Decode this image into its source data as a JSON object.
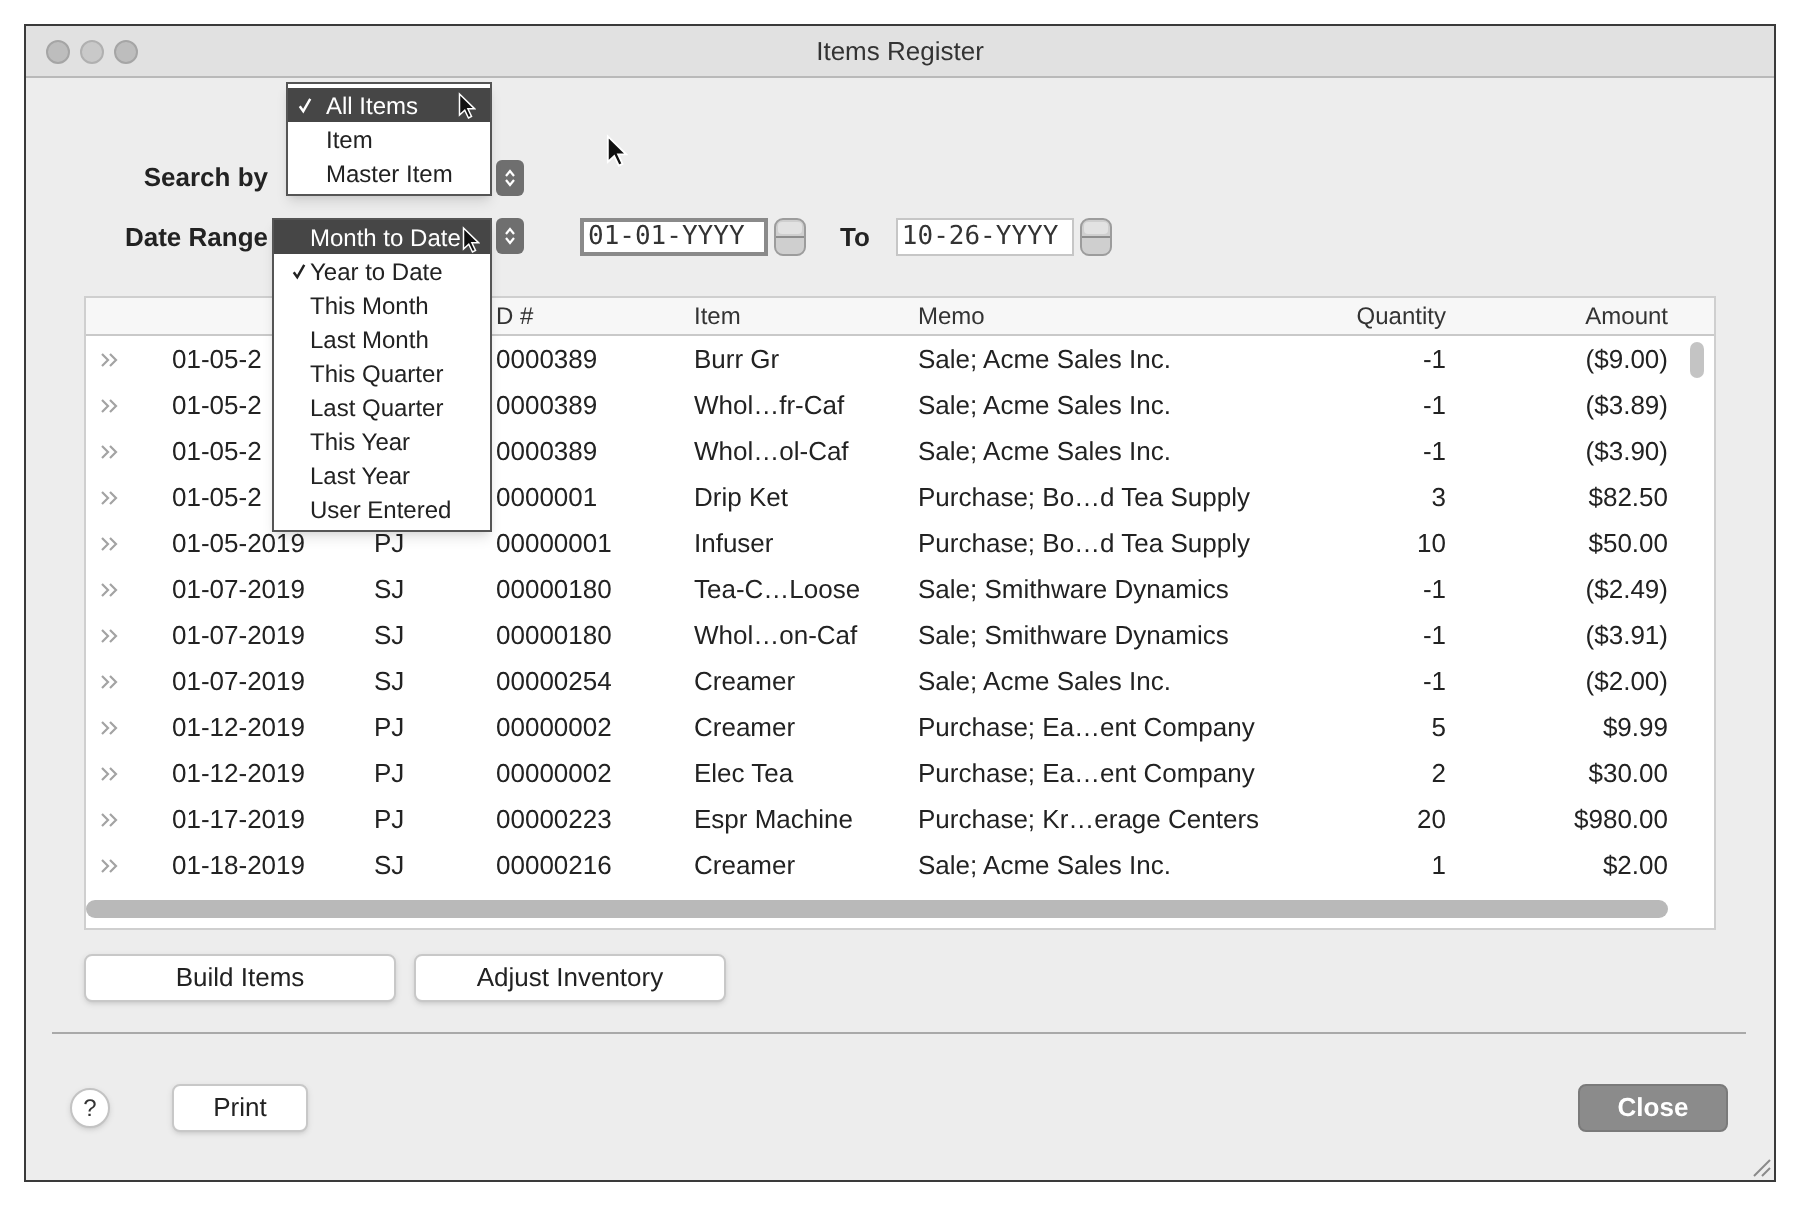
{
  "window": {
    "title": "Items Register"
  },
  "search_by": {
    "label": "Search by",
    "menu": [
      {
        "label": "All Items",
        "checked": true,
        "selected": true
      },
      {
        "label": "Item",
        "checked": false,
        "selected": false
      },
      {
        "label": "Master Item",
        "checked": false,
        "selected": false
      }
    ]
  },
  "date_range": {
    "label": "Date Range",
    "menu": [
      {
        "label": "Month to Date",
        "checked": false,
        "selected": true
      },
      {
        "label": "Year to Date",
        "checked": true,
        "selected": false
      },
      {
        "label": "This Month",
        "checked": false,
        "selected": false
      },
      {
        "label": "Last Month",
        "checked": false,
        "selected": false
      },
      {
        "label": "This Quarter",
        "checked": false,
        "selected": false
      },
      {
        "label": "Last Quarter",
        "checked": false,
        "selected": false
      },
      {
        "label": "This Year",
        "checked": false,
        "selected": false
      },
      {
        "label": "Last Year",
        "checked": false,
        "selected": false
      },
      {
        "label": "User Entered",
        "checked": false,
        "selected": false
      }
    ],
    "from": {
      "value": "01-01-YYYY",
      "focused": true
    },
    "to_label": "To",
    "to": {
      "value": "10-26-YYYY",
      "focused": false
    }
  },
  "table": {
    "columns": [
      "D #",
      "Item",
      "Memo",
      "Quantity",
      "Amount"
    ],
    "rows": [
      {
        "date": "01-05-2",
        "id": "0000389",
        "item": "Burr Gr",
        "memo": "Sale; Acme Sales Inc.",
        "quantity": "-1",
        "amount": "($9.00)"
      },
      {
        "date": "01-05-2",
        "id": "0000389",
        "item": "Whol…fr-Caf",
        "memo": "Sale; Acme Sales Inc.",
        "quantity": "-1",
        "amount": "($3.89)"
      },
      {
        "date": "01-05-2",
        "id": "0000389",
        "item": "Whol…ol-Caf",
        "memo": "Sale; Acme Sales Inc.",
        "quantity": "-1",
        "amount": "($3.90)"
      },
      {
        "date": "01-05-2",
        "id": "0000001",
        "item": "Drip Ket",
        "memo": "Purchase; Bo…d Tea Supply",
        "quantity": "3",
        "amount": "$82.50"
      },
      {
        "date": "01-05-2019",
        "journal": "PJ",
        "id": "00000001",
        "item": "Infuser",
        "memo": "Purchase; Bo…d Tea Supply",
        "quantity": "10",
        "amount": "$50.00"
      },
      {
        "date": "01-07-2019",
        "journal": "SJ",
        "id": "00000180",
        "item": "Tea-C…Loose",
        "memo": "Sale; Smithware Dynamics",
        "quantity": "-1",
        "amount": "($2.49)"
      },
      {
        "date": "01-07-2019",
        "journal": "SJ",
        "id": "00000180",
        "item": "Whol…on-Caf",
        "memo": "Sale; Smithware Dynamics",
        "quantity": "-1",
        "amount": "($3.91)"
      },
      {
        "date": "01-07-2019",
        "journal": "SJ",
        "id": "00000254",
        "item": "Creamer",
        "memo": "Sale; Acme Sales Inc.",
        "quantity": "-1",
        "amount": "($2.00)"
      },
      {
        "date": "01-12-2019",
        "journal": "PJ",
        "id": "00000002",
        "item": "Creamer",
        "memo": "Purchase; Ea…ent Company",
        "quantity": "5",
        "amount": "$9.99"
      },
      {
        "date": "01-12-2019",
        "journal": "PJ",
        "id": "00000002",
        "item": "Elec Tea",
        "memo": "Purchase; Ea…ent Company",
        "quantity": "2",
        "amount": "$30.00"
      },
      {
        "date": "01-17-2019",
        "journal": "PJ",
        "id": "00000223",
        "item": "Espr Machine",
        "memo": "Purchase; Kr…erage Centers",
        "quantity": "20",
        "amount": "$980.00"
      },
      {
        "date": "01-18-2019",
        "journal": "SJ",
        "id": "00000216",
        "item": "Creamer",
        "memo": "Sale; Acme Sales Inc.",
        "quantity": "1",
        "amount": "$2.00"
      }
    ]
  },
  "actions": [
    "Build Items",
    "Adjust Inventory"
  ],
  "footer": {
    "help": "?",
    "print": "Print",
    "close": "Close"
  }
}
